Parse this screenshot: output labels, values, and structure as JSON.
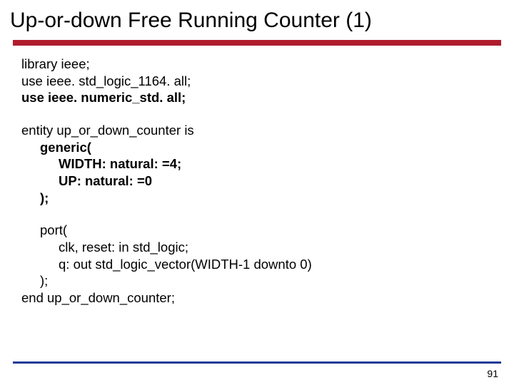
{
  "title": "Up-or-down Free Running Counter (1)",
  "libs": {
    "l1": "library ieee;",
    "l2": "use ieee. std_logic_1164. all;",
    "l3": "use ieee. numeric_std. all;"
  },
  "entity": {
    "l1": "entity up_or_down_counter is",
    "l2": "generic(",
    "l3": "WIDTH: natural: =4;",
    "l4": "UP: natural: =0",
    "l5": ");"
  },
  "port": {
    "l1": "port(",
    "l2": "clk, reset: in std_logic;",
    "l3": "q: out std_logic_vector(WIDTH-1 downto 0)",
    "l4": ");",
    "l5": "end up_or_down_counter;"
  },
  "page_number": "91"
}
